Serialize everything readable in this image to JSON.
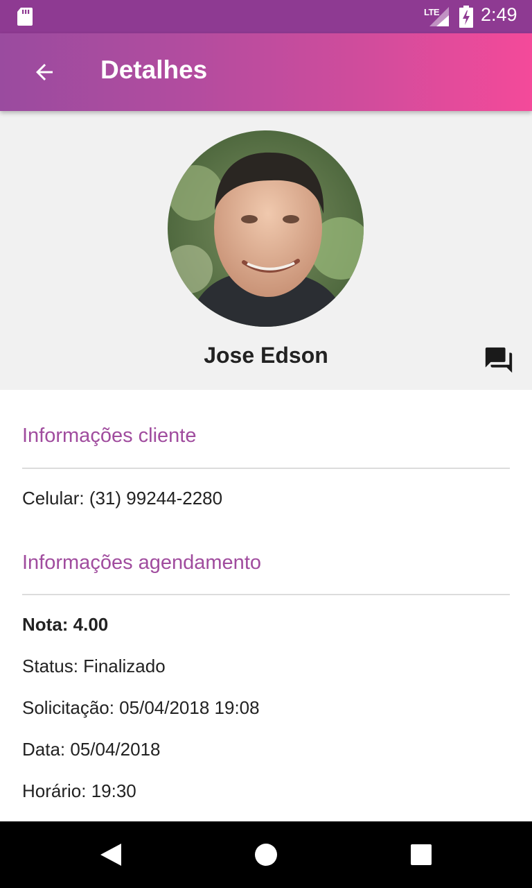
{
  "status_bar": {
    "network_label": "LTE",
    "time": "2:49",
    "icons": [
      "sd-card-icon",
      "signal-icon",
      "battery-charging-icon"
    ]
  },
  "app_bar": {
    "title": "Detalhes",
    "back_icon": "arrow-back-icon",
    "gradient_colors": [
      "#9a4b9f",
      "#f44a9a"
    ]
  },
  "profile": {
    "name": "Jose Edson",
    "chat_icon": "chat-bubbles-icon"
  },
  "sections": {
    "client": {
      "title": "Informações cliente",
      "phone": "Celular: (31) 99244-2280"
    },
    "schedule": {
      "title": "Informações agendamento",
      "rating": "Nota: 4.00",
      "status": "Status: Finalizado",
      "request": "Solicitação: 05/04/2018 19:08",
      "date": "Data: 05/04/2018",
      "time": "Horário: 19:30"
    }
  },
  "nav_bar": {
    "icons": [
      "nav-back-icon",
      "nav-home-icon",
      "nav-recents-icon"
    ]
  },
  "colors": {
    "accent": "#a04c9e",
    "status_bar": "#8e3a92"
  }
}
